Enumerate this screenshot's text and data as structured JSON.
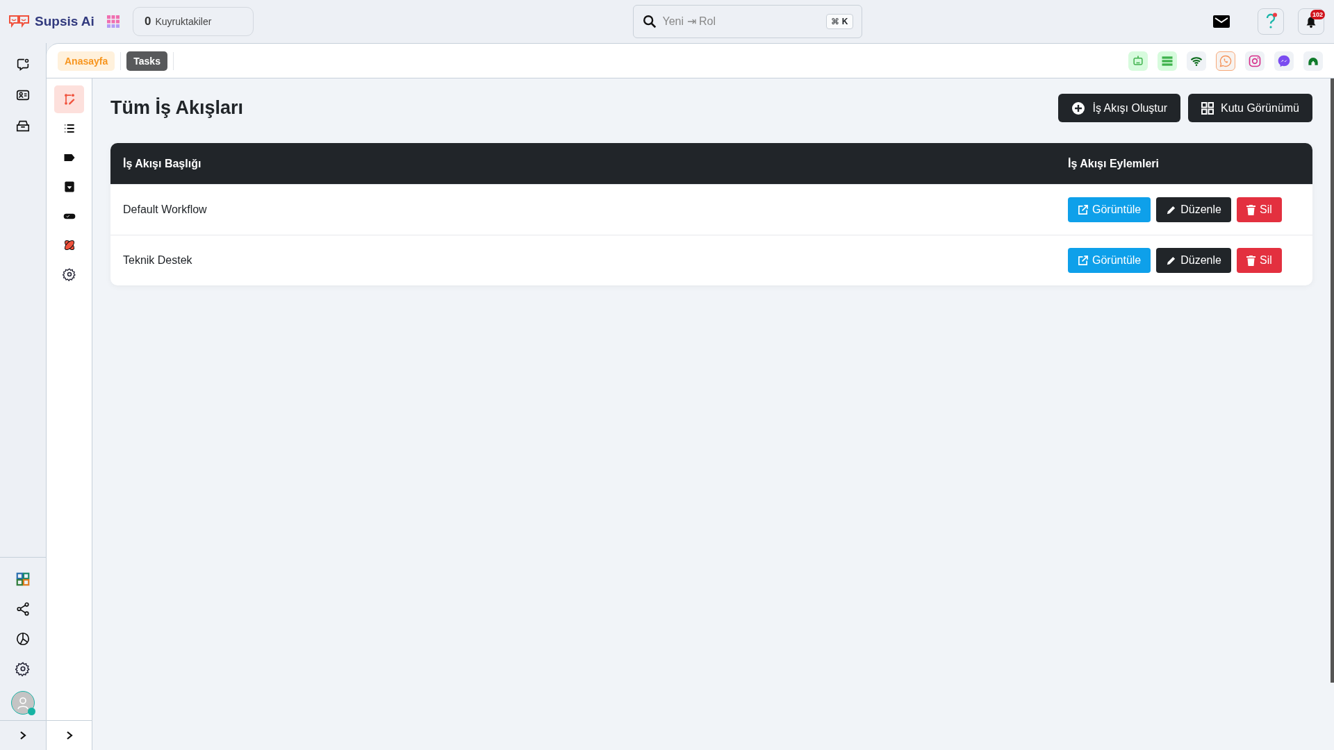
{
  "brand": {
    "name": "Supsis Ai"
  },
  "queue": {
    "count": "0",
    "label": "Kuyruktakiler"
  },
  "search": {
    "placeholder": "Yeni ⇥ Rol",
    "shortcut_symbol": "⌘",
    "shortcut_key": "K"
  },
  "notifications": {
    "count": "102"
  },
  "rail_top": [
    {
      "kind": "chat"
    },
    {
      "kind": "contact"
    },
    {
      "kind": "inbox"
    }
  ],
  "rail_bottom": [
    {
      "kind": "apps"
    },
    {
      "kind": "share"
    },
    {
      "kind": "chart"
    },
    {
      "kind": "settings"
    }
  ],
  "breadcrumbs": [
    {
      "label": "Anasayfa",
      "selected": false
    },
    {
      "label": "Tasks",
      "selected": true
    }
  ],
  "channels": [
    {
      "kind": "bot",
      "selected": false
    },
    {
      "kind": "list",
      "selected": false
    },
    {
      "kind": "wifi",
      "selected": false
    },
    {
      "kind": "whatsapp",
      "selected": true
    },
    {
      "kind": "instagram",
      "selected": false
    },
    {
      "kind": "messenger",
      "selected": false
    },
    {
      "kind": "support",
      "selected": false
    }
  ],
  "subnav": [
    {
      "kind": "workflow",
      "selected": true
    },
    {
      "kind": "list",
      "selected": false
    },
    {
      "kind": "tag",
      "selected": false
    },
    {
      "kind": "archive",
      "selected": false
    },
    {
      "kind": "toggle",
      "selected": false
    },
    {
      "kind": "integration",
      "selected": false
    },
    {
      "kind": "settings",
      "selected": false
    }
  ],
  "page": {
    "title": "Tüm İş Akışları",
    "buttons": [
      {
        "kind": "create",
        "label": "İş Akışı Oluştur"
      },
      {
        "kind": "grid",
        "label": "Kutu Görünümü"
      }
    ]
  },
  "table": {
    "columns": [
      "İş Akışı Başlığı",
      "İş Akışı Eylemleri"
    ],
    "rows": [
      {
        "title": "Default Workflow",
        "actions": [
          {
            "kind": "view",
            "label": "Görüntüle"
          },
          {
            "kind": "edit",
            "label": "Düzenle"
          },
          {
            "kind": "delete",
            "label": "Sil"
          }
        ]
      },
      {
        "title": "Teknik Destek",
        "actions": [
          {
            "kind": "view",
            "label": "Görüntüle"
          },
          {
            "kind": "edit",
            "label": "Düzenle"
          },
          {
            "kind": "delete",
            "label": "Sil"
          }
        ]
      }
    ]
  }
}
